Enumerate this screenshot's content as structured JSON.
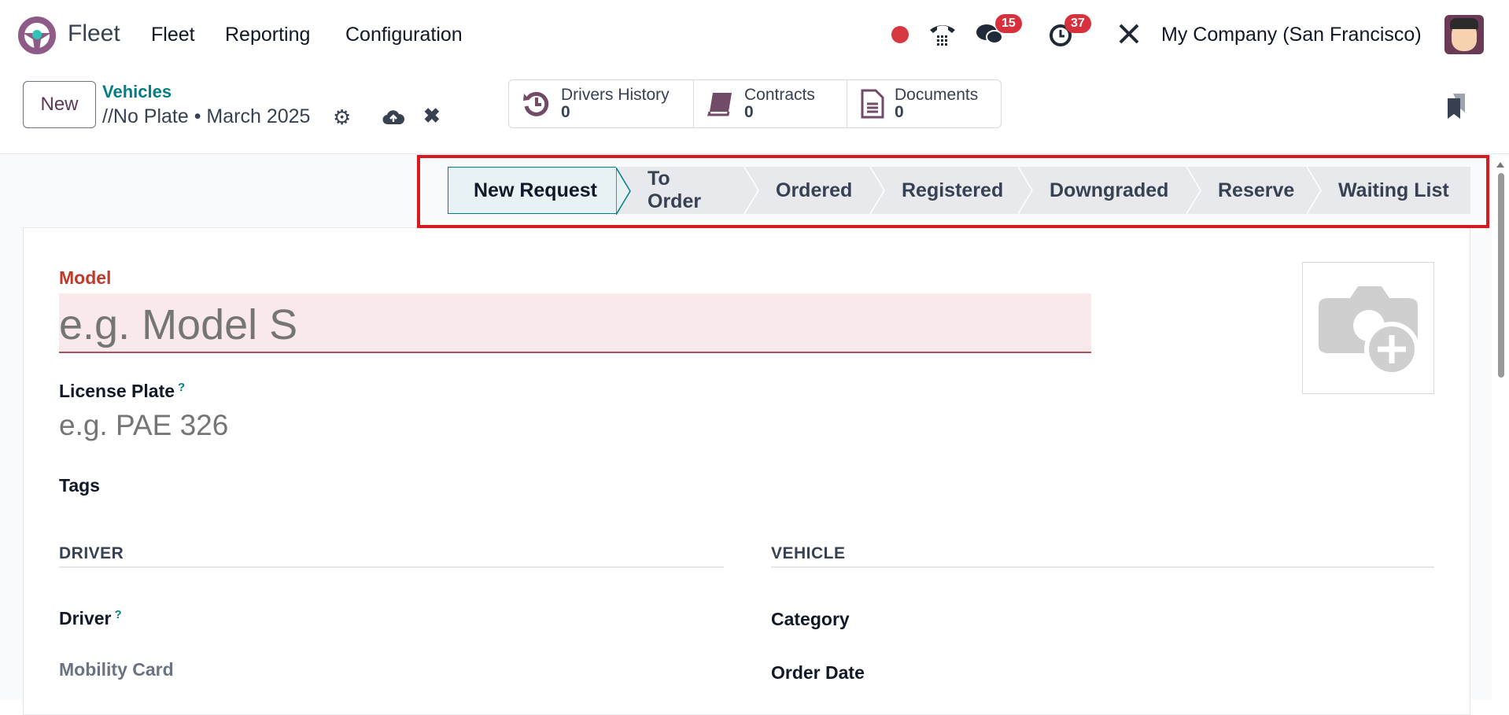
{
  "navbar": {
    "app_name": "Fleet",
    "menu": [
      "Fleet",
      "Reporting",
      "Configuration"
    ],
    "messages_count": "15",
    "activities_count": "37",
    "company": "My Company (San Francisco)"
  },
  "control_panel": {
    "new_label": "New",
    "breadcrumb_parent": "Vehicles",
    "record_title": "//No Plate • March 2025",
    "stats": [
      {
        "label": "Drivers History",
        "value": "0"
      },
      {
        "label": "Contracts",
        "value": "0"
      },
      {
        "label": "Documents",
        "value": "0"
      }
    ]
  },
  "statusbar": {
    "stages": [
      "New Request",
      "To Order",
      "Ordered",
      "Registered",
      "Downgraded",
      "Reserve",
      "Waiting List"
    ],
    "active": "New Request"
  },
  "form": {
    "model_label": "Model",
    "model_placeholder": "e.g. Model S",
    "plate_label": "License Plate",
    "plate_placeholder": "e.g. PAE 326",
    "help_mark": "?",
    "tags_label": "Tags",
    "driver_section": "DRIVER",
    "vehicle_section": "VEHICLE",
    "driver_label": "Driver",
    "mobility_label": "Mobility Card",
    "category_label": "Category",
    "order_date_label": "Order Date"
  },
  "colors": {
    "accent": "#017e84",
    "brand": "#714b67",
    "highlight": "#d71920",
    "badge": "#d9303e"
  }
}
